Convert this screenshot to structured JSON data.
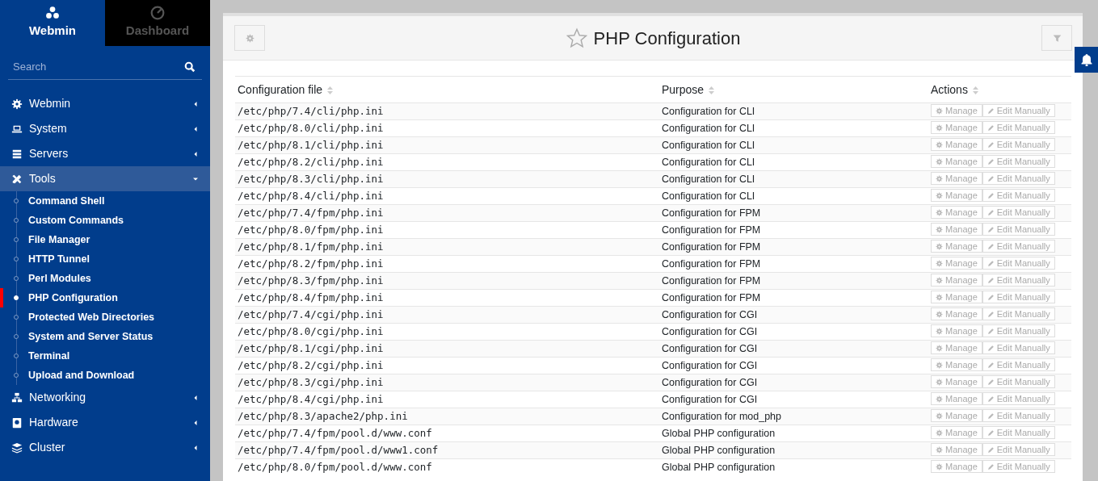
{
  "sidebar": {
    "brand_tabs": [
      {
        "label": "Webmin",
        "selected": true
      },
      {
        "label": "Dashboard",
        "selected": false
      }
    ],
    "search": {
      "placeholder": "Search"
    },
    "menu": [
      {
        "label": "Webmin",
        "expanded": false
      },
      {
        "label": "System",
        "expanded": false
      },
      {
        "label": "Servers",
        "expanded": false
      },
      {
        "label": "Tools",
        "expanded": true,
        "children": [
          {
            "label": "Command Shell",
            "selected": false
          },
          {
            "label": "Custom Commands",
            "selected": false
          },
          {
            "label": "File Manager",
            "selected": false
          },
          {
            "label": "HTTP Tunnel",
            "selected": false
          },
          {
            "label": "Perl Modules",
            "selected": false
          },
          {
            "label": "PHP Configuration",
            "selected": true
          },
          {
            "label": "Protected Web Directories",
            "selected": false
          },
          {
            "label": "System and Server Status",
            "selected": false
          },
          {
            "label": "Terminal",
            "selected": false
          },
          {
            "label": "Upload and Download",
            "selected": false
          }
        ]
      },
      {
        "label": "Networking",
        "expanded": false
      },
      {
        "label": "Hardware",
        "expanded": false
      },
      {
        "label": "Cluster",
        "expanded": false
      }
    ]
  },
  "page": {
    "title": "PHP Configuration",
    "favorite": false
  },
  "table": {
    "columns": [
      "Configuration file",
      "Purpose",
      "Actions"
    ],
    "rows": [
      {
        "file": "/etc/php/7.4/cli/php.ini",
        "purpose": "Configuration for CLI",
        "actions": [
          "Manage",
          "Edit Manually"
        ]
      },
      {
        "file": "/etc/php/8.0/cli/php.ini",
        "purpose": "Configuration for CLI",
        "actions": [
          "Manage",
          "Edit Manually"
        ]
      },
      {
        "file": "/etc/php/8.1/cli/php.ini",
        "purpose": "Configuration for CLI",
        "actions": [
          "Manage",
          "Edit Manually"
        ]
      },
      {
        "file": "/etc/php/8.2/cli/php.ini",
        "purpose": "Configuration for CLI",
        "actions": [
          "Manage",
          "Edit Manually"
        ]
      },
      {
        "file": "/etc/php/8.3/cli/php.ini",
        "purpose": "Configuration for CLI",
        "actions": [
          "Manage",
          "Edit Manually"
        ]
      },
      {
        "file": "/etc/php/8.4/cli/php.ini",
        "purpose": "Configuration for CLI",
        "actions": [
          "Manage",
          "Edit Manually"
        ]
      },
      {
        "file": "/etc/php/7.4/fpm/php.ini",
        "purpose": "Configuration for FPM",
        "actions": [
          "Manage",
          "Edit Manually"
        ]
      },
      {
        "file": "/etc/php/8.0/fpm/php.ini",
        "purpose": "Configuration for FPM",
        "actions": [
          "Manage",
          "Edit Manually"
        ]
      },
      {
        "file": "/etc/php/8.1/fpm/php.ini",
        "purpose": "Configuration for FPM",
        "actions": [
          "Manage",
          "Edit Manually"
        ]
      },
      {
        "file": "/etc/php/8.2/fpm/php.ini",
        "purpose": "Configuration for FPM",
        "actions": [
          "Manage",
          "Edit Manually"
        ]
      },
      {
        "file": "/etc/php/8.3/fpm/php.ini",
        "purpose": "Configuration for FPM",
        "actions": [
          "Manage",
          "Edit Manually"
        ]
      },
      {
        "file": "/etc/php/8.4/fpm/php.ini",
        "purpose": "Configuration for FPM",
        "actions": [
          "Manage",
          "Edit Manually"
        ]
      },
      {
        "file": "/etc/php/7.4/cgi/php.ini",
        "purpose": "Configuration for CGI",
        "actions": [
          "Manage",
          "Edit Manually"
        ]
      },
      {
        "file": "/etc/php/8.0/cgi/php.ini",
        "purpose": "Configuration for CGI",
        "actions": [
          "Manage",
          "Edit Manually"
        ]
      },
      {
        "file": "/etc/php/8.1/cgi/php.ini",
        "purpose": "Configuration for CGI",
        "actions": [
          "Manage",
          "Edit Manually"
        ]
      },
      {
        "file": "/etc/php/8.2/cgi/php.ini",
        "purpose": "Configuration for CGI",
        "actions": [
          "Manage",
          "Edit Manually"
        ]
      },
      {
        "file": "/etc/php/8.3/cgi/php.ini",
        "purpose": "Configuration for CGI",
        "actions": [
          "Manage",
          "Edit Manually"
        ]
      },
      {
        "file": "/etc/php/8.4/cgi/php.ini",
        "purpose": "Configuration for CGI",
        "actions": [
          "Manage",
          "Edit Manually"
        ]
      },
      {
        "file": "/etc/php/8.3/apache2/php.ini",
        "purpose": "Configuration for mod_php",
        "actions": [
          "Manage",
          "Edit Manually"
        ]
      },
      {
        "file": "/etc/php/7.4/fpm/pool.d/www.conf",
        "purpose": "Global PHP configuration",
        "actions": [
          "Manage",
          "Edit Manually"
        ]
      },
      {
        "file": "/etc/php/7.4/fpm/pool.d/www1.conf",
        "purpose": "Global PHP configuration",
        "actions": [
          "Manage",
          "Edit Manually"
        ]
      },
      {
        "file": "/etc/php/8.0/fpm/pool.d/www.conf",
        "purpose": "Global PHP configuration",
        "actions": [
          "Manage",
          "Edit Manually"
        ]
      }
    ]
  }
}
